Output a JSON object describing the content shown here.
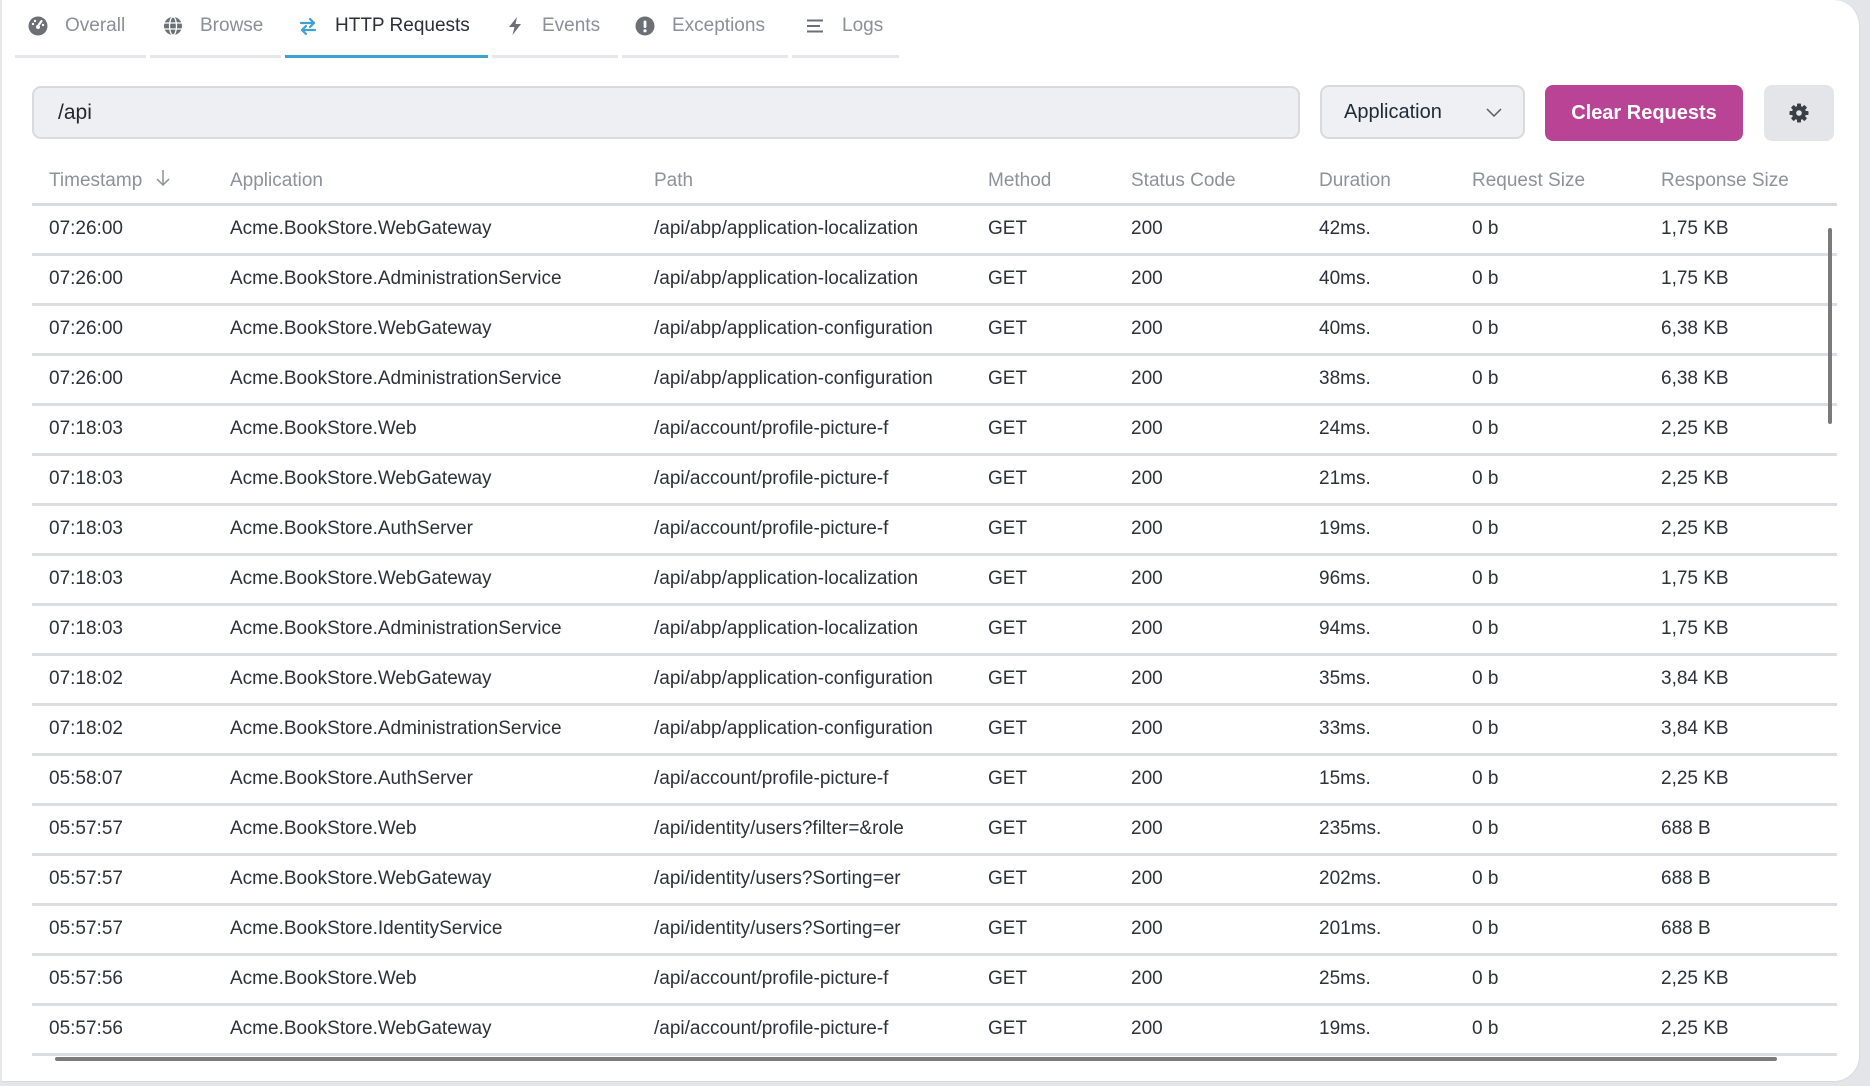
{
  "tabs": [
    {
      "label": "Overall",
      "icon": "gauge-icon",
      "active": false
    },
    {
      "label": "Browse",
      "icon": "globe-icon",
      "active": false
    },
    {
      "label": "HTTP Requests",
      "icon": "arrows-exchange-icon",
      "active": true
    },
    {
      "label": "Events",
      "icon": "bolt-icon",
      "active": false
    },
    {
      "label": "Exceptions",
      "icon": "exclamation-circle-icon",
      "active": false
    },
    {
      "label": "Logs",
      "icon": "list-icon",
      "active": false
    }
  ],
  "toolbar": {
    "search_value": "/api",
    "application_select": "Application",
    "clear_label": "Clear Requests",
    "settings_icon": "gear-icon"
  },
  "colors": {
    "accent": "#3ea0cd",
    "clear_button": "#b94395"
  },
  "table": {
    "columns": [
      "Timestamp",
      "Application",
      "Path",
      "Method",
      "Status Code",
      "Duration",
      "Request Size",
      "Response Size"
    ],
    "sort_column": "Timestamp",
    "sort_direction": "descending",
    "rows": [
      [
        "07:26:00",
        "Acme.BookStore.WebGateway",
        "/api/abp/application-localization",
        "GET",
        "200",
        "42ms.",
        "0 b",
        "1,75 KB"
      ],
      [
        "07:26:00",
        "Acme.BookStore.AdministrationService",
        "/api/abp/application-localization",
        "GET",
        "200",
        "40ms.",
        "0 b",
        "1,75 KB"
      ],
      [
        "07:26:00",
        "Acme.BookStore.WebGateway",
        "/api/abp/application-configuration",
        "GET",
        "200",
        "40ms.",
        "0 b",
        "6,38 KB"
      ],
      [
        "07:26:00",
        "Acme.BookStore.AdministrationService",
        "/api/abp/application-configuration",
        "GET",
        "200",
        "38ms.",
        "0 b",
        "6,38 KB"
      ],
      [
        "07:18:03",
        "Acme.BookStore.Web",
        "/api/account/profile-picture-f",
        "GET",
        "200",
        "24ms.",
        "0 b",
        "2,25 KB"
      ],
      [
        "07:18:03",
        "Acme.BookStore.WebGateway",
        "/api/account/profile-picture-f",
        "GET",
        "200",
        "21ms.",
        "0 b",
        "2,25 KB"
      ],
      [
        "07:18:03",
        "Acme.BookStore.AuthServer",
        "/api/account/profile-picture-f",
        "GET",
        "200",
        "19ms.",
        "0 b",
        "2,25 KB"
      ],
      [
        "07:18:03",
        "Acme.BookStore.WebGateway",
        "/api/abp/application-localization",
        "GET",
        "200",
        "96ms.",
        "0 b",
        "1,75 KB"
      ],
      [
        "07:18:03",
        "Acme.BookStore.AdministrationService",
        "/api/abp/application-localization",
        "GET",
        "200",
        "94ms.",
        "0 b",
        "1,75 KB"
      ],
      [
        "07:18:02",
        "Acme.BookStore.WebGateway",
        "/api/abp/application-configuration",
        "GET",
        "200",
        "35ms.",
        "0 b",
        "3,84 KB"
      ],
      [
        "07:18:02",
        "Acme.BookStore.AdministrationService",
        "/api/abp/application-configuration",
        "GET",
        "200",
        "33ms.",
        "0 b",
        "3,84 KB"
      ],
      [
        "05:58:07",
        "Acme.BookStore.AuthServer",
        "/api/account/profile-picture-f",
        "GET",
        "200",
        "15ms.",
        "0 b",
        "2,25 KB"
      ],
      [
        "05:57:57",
        "Acme.BookStore.Web",
        "/api/identity/users?filter=&role",
        "GET",
        "200",
        "235ms.",
        "0 b",
        "688 B"
      ],
      [
        "05:57:57",
        "Acme.BookStore.WebGateway",
        "/api/identity/users?Sorting=er",
        "GET",
        "200",
        "202ms.",
        "0 b",
        "688 B"
      ],
      [
        "05:57:57",
        "Acme.BookStore.IdentityService",
        "/api/identity/users?Sorting=er",
        "GET",
        "200",
        "201ms.",
        "0 b",
        "688 B"
      ],
      [
        "05:57:56",
        "Acme.BookStore.Web",
        "/api/account/profile-picture-f",
        "GET",
        "200",
        "25ms.",
        "0 b",
        "2,25 KB"
      ],
      [
        "05:57:56",
        "Acme.BookStore.WebGateway",
        "/api/account/profile-picture-f",
        "GET",
        "200",
        "19ms.",
        "0 b",
        "2,25 KB"
      ]
    ]
  }
}
